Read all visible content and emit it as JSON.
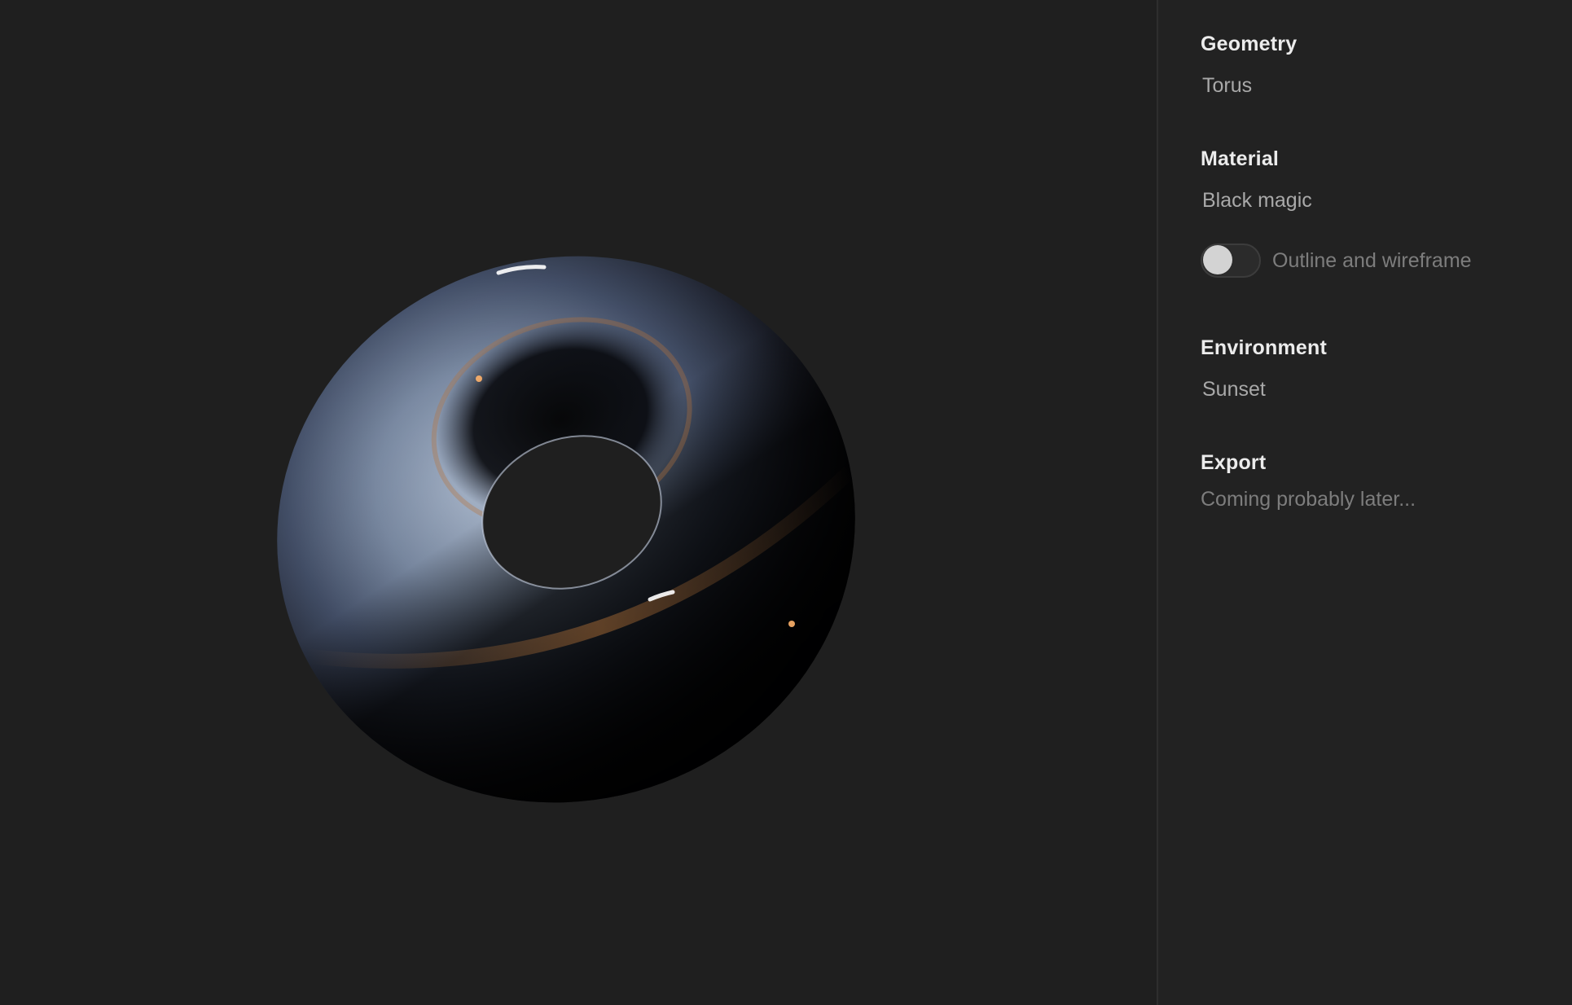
{
  "viewport": {
    "object": "torus",
    "background": "#1f1f1f"
  },
  "sidebar": {
    "geometry": {
      "title": "Geometry",
      "value": "Torus"
    },
    "material": {
      "title": "Material",
      "value": "Black magic",
      "toggle": {
        "label": "Outline and wireframe",
        "enabled": false
      }
    },
    "environment": {
      "title": "Environment",
      "value": "Sunset"
    },
    "export": {
      "title": "Export",
      "note": "Coming probably later..."
    }
  },
  "colors": {
    "background": "#1f1f1f",
    "sidebar": "#222222",
    "heading": "#ececec",
    "option": "#a9a9a9",
    "muted": "#7d7d7d"
  }
}
